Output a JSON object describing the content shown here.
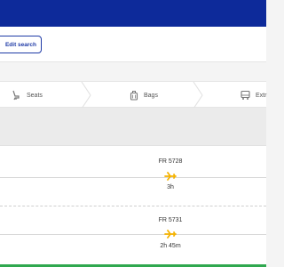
{
  "search": {
    "edit_label": "Edit search"
  },
  "steps": [
    {
      "label": "Seats",
      "icon": "seat-icon"
    },
    {
      "label": "Bags",
      "icon": "bag-icon"
    },
    {
      "label": "Extr",
      "icon": "extras-icon"
    }
  ],
  "flights": [
    {
      "number": "FR 5728",
      "duration": "3h"
    },
    {
      "number": "FR 5731",
      "duration": "2h 45m"
    }
  ],
  "colors": {
    "brand": "#0d2a9a",
    "accent": "#f5b301",
    "success": "#2fa84f"
  }
}
